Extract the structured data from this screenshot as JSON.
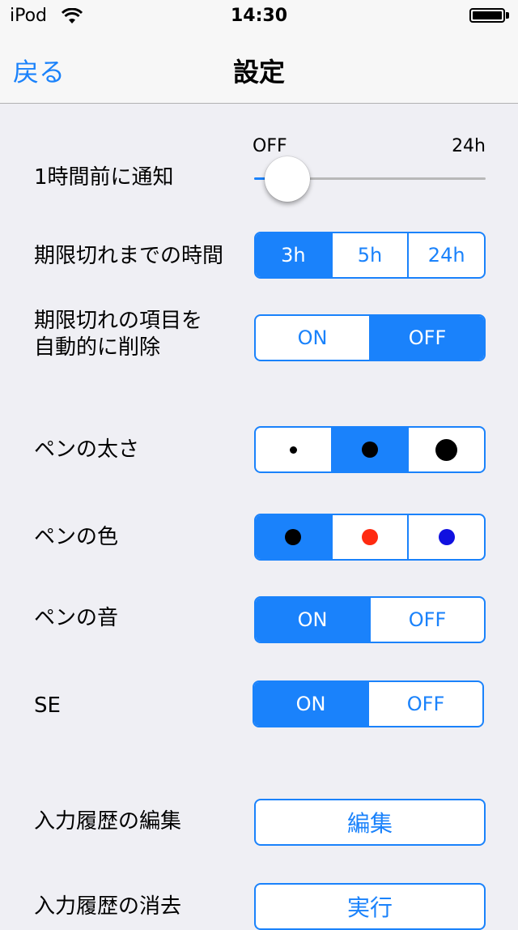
{
  "status_bar": {
    "carrier": "iPod",
    "time": "14:30"
  },
  "nav": {
    "back_label": "戻る",
    "title": "設定"
  },
  "notify": {
    "label": "1時間前に通知",
    "min_label": "OFF",
    "max_label": "24h",
    "value_fraction": 0.05
  },
  "expire_time": {
    "label": "期限切れまでの時間",
    "options": [
      "3h",
      "5h",
      "24h"
    ],
    "selected": "3h"
  },
  "auto_delete": {
    "label_line1": "期限切れの項目を",
    "label_line2": "自動的に削除",
    "options": [
      "ON",
      "OFF"
    ],
    "selected": "OFF"
  },
  "pen_width": {
    "label": "ペンの太さ",
    "options": [
      "small-dot-icon",
      "medium-dot-icon",
      "large-dot-icon"
    ],
    "selected": "medium-dot-icon"
  },
  "pen_color": {
    "label": "ペンの色",
    "options": [
      "#000000",
      "#ff2a10",
      "#1010e0"
    ],
    "selected": "#000000"
  },
  "pen_sound": {
    "label": "ペンの音",
    "options": [
      "ON",
      "OFF"
    ],
    "selected": "ON"
  },
  "se": {
    "label": "SE",
    "options": [
      "ON",
      "OFF"
    ],
    "selected": "ON"
  },
  "history_edit": {
    "label": "入力履歴の編集",
    "button_label": "編集"
  },
  "history_clear": {
    "label": "入力履歴の消去",
    "button_label": "実行"
  },
  "colors": {
    "accent": "#1a82fb",
    "background": "#efeff4"
  }
}
